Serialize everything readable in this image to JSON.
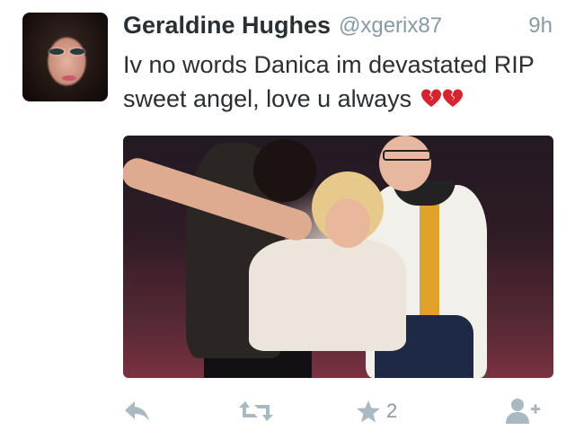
{
  "tweet": {
    "display_name": "Geraldine Hughes",
    "handle": "@xgerix87",
    "time": "9h",
    "text_line1": "Iv no words Danica im devastated RIP",
    "text_line2": "sweet angel, love u always",
    "emoji": [
      "broken-heart",
      "broken-heart"
    ]
  },
  "actions": {
    "reply_icon": "reply-arrow-icon",
    "retweet_icon": "retweet-icon",
    "favorite_icon": "star-icon",
    "favorite_count": "2",
    "follow_icon": "add-user-icon"
  },
  "colors": {
    "name": "#292f33",
    "meta": "#8899a6",
    "action_icon": "#aab8c2",
    "broken_heart": "#d6232e"
  }
}
